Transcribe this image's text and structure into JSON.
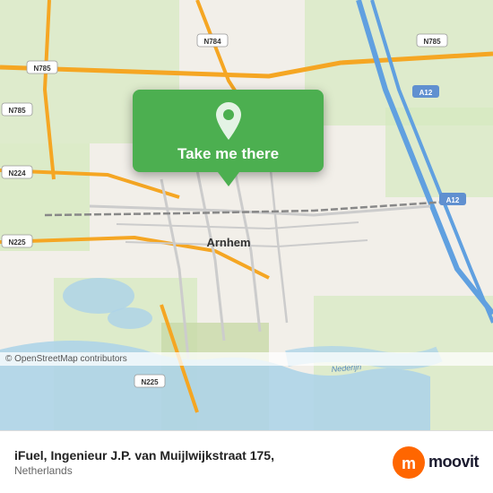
{
  "map": {
    "attribution": "© OpenStreetMap contributors",
    "city_label": "Arnhem"
  },
  "popup": {
    "button_label": "Take me there"
  },
  "footer": {
    "location_name": "iFuel, Ingenieur J.P. van Muijlwijkstraat 175,",
    "location_country": "Netherlands",
    "moovit_text": "moovit"
  }
}
